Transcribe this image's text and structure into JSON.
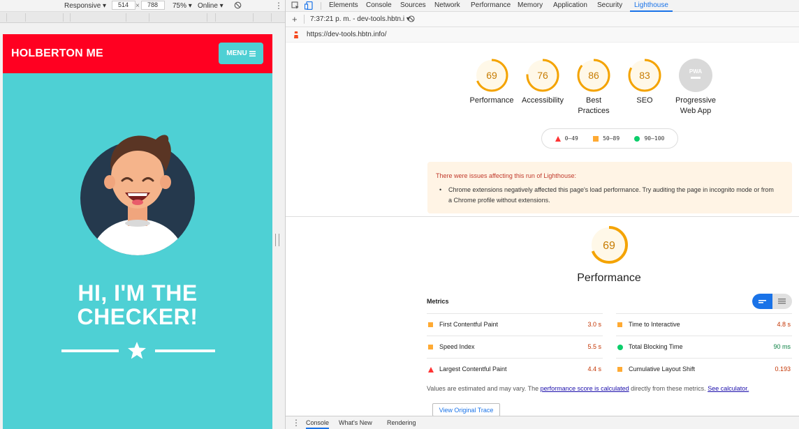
{
  "device_toolbar": {
    "device": "Responsive",
    "width": "514",
    "x": "×",
    "height": "788",
    "zoom": "75%",
    "throttle": "Online"
  },
  "mobile": {
    "brand": "HOLBERTON ME",
    "menu_label": "MENU",
    "hero_line1": "HI, I'M THE",
    "hero_line2": "CHECKER!",
    "colors": {
      "header": "#ff0021",
      "body": "#4ed0d4"
    }
  },
  "devtools": {
    "tabs": [
      "Elements",
      "Console",
      "Sources",
      "Network",
      "Performance",
      "Memory",
      "Application",
      "Security",
      "Lighthouse"
    ],
    "active_tab": "Lighthouse",
    "report_selector": "7:37:21 p. m. - dev-tools.hbtn.i",
    "url": "https://dev-tools.hbtn.info/",
    "scores": [
      {
        "value": "69",
        "label": "Performance",
        "color": "#f4a300"
      },
      {
        "value": "76",
        "label": "Accessibility",
        "color": "#f4a300"
      },
      {
        "value": "86",
        "label": "Best Practices",
        "color": "#f4a300"
      },
      {
        "value": "83",
        "label": "SEO",
        "color": "#f4a300"
      },
      {
        "value": "PWA",
        "label": "Progressive Web App",
        "color": "#bdbdbd"
      }
    ],
    "legend": [
      {
        "range": "0–49",
        "color": "#ff3333",
        "shape": "triangle"
      },
      {
        "range": "50–89",
        "color": "#ffaa33",
        "shape": "square"
      },
      {
        "range": "90–100",
        "color": "#0cce6b",
        "shape": "circle"
      }
    ],
    "warning": {
      "title": "There were issues affecting this run of Lighthouse:",
      "item": "Chrome extensions negatively affected this page's load performance. Try auditing the page in incognito mode or from a Chrome profile without extensions."
    },
    "performance": {
      "score": "69",
      "title": "Performance",
      "metrics_label": "Metrics",
      "metrics": [
        {
          "name": "First Contentful Paint",
          "value": "3.0 s",
          "status": "average"
        },
        {
          "name": "Time to Interactive",
          "value": "4.8 s",
          "status": "average"
        },
        {
          "name": "Speed Index",
          "value": "5.5 s",
          "status": "average"
        },
        {
          "name": "Total Blocking Time",
          "value": "90 ms",
          "status": "pass"
        },
        {
          "name": "Largest Contentful Paint",
          "value": "4.4 s",
          "status": "fail"
        },
        {
          "name": "Cumulative Layout Shift",
          "value": "0.193",
          "status": "average"
        }
      ],
      "note_pre": "Values are estimated and may vary. The ",
      "note_link1": "performance score is calculated",
      "note_mid": " directly from these metrics. ",
      "note_link2": "See calculator.",
      "trace_button": "View Original Trace"
    },
    "drawer_tabs": [
      "Console",
      "What's New",
      "Rendering"
    ]
  }
}
